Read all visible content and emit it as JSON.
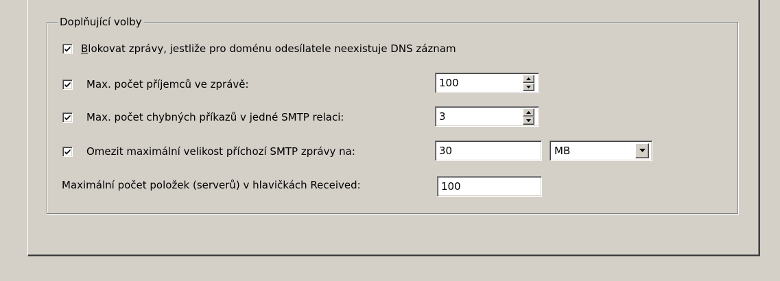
{
  "group": {
    "title": "Doplňující volby"
  },
  "options": {
    "block_dns": {
      "checked": true,
      "label_first": "B",
      "label_rest": "lokovat zprávy, jestliže pro doménu odesílatele neexistuje DNS záznam"
    },
    "max_recipients": {
      "checked": true,
      "label": "Max. počet příjemců ve zprávě:",
      "value": "100"
    },
    "max_bad_commands": {
      "checked": true,
      "label": "Max. počet chybných příkazů v jedné SMTP relaci:",
      "value": "3"
    },
    "max_size": {
      "checked": true,
      "label": "Omezit maximální velikost příchozí SMTP zprávy na:",
      "value": "30",
      "unit": "MB"
    },
    "max_received": {
      "label": "Maximální počet položek (serverů) v hlavičkách Received:",
      "value": "100"
    }
  },
  "icons": {
    "checkbox": "checkmark-icon",
    "spin_up": "arrow-up-icon",
    "spin_down": "arrow-down-icon",
    "dropdown": "chevron-down-icon"
  }
}
